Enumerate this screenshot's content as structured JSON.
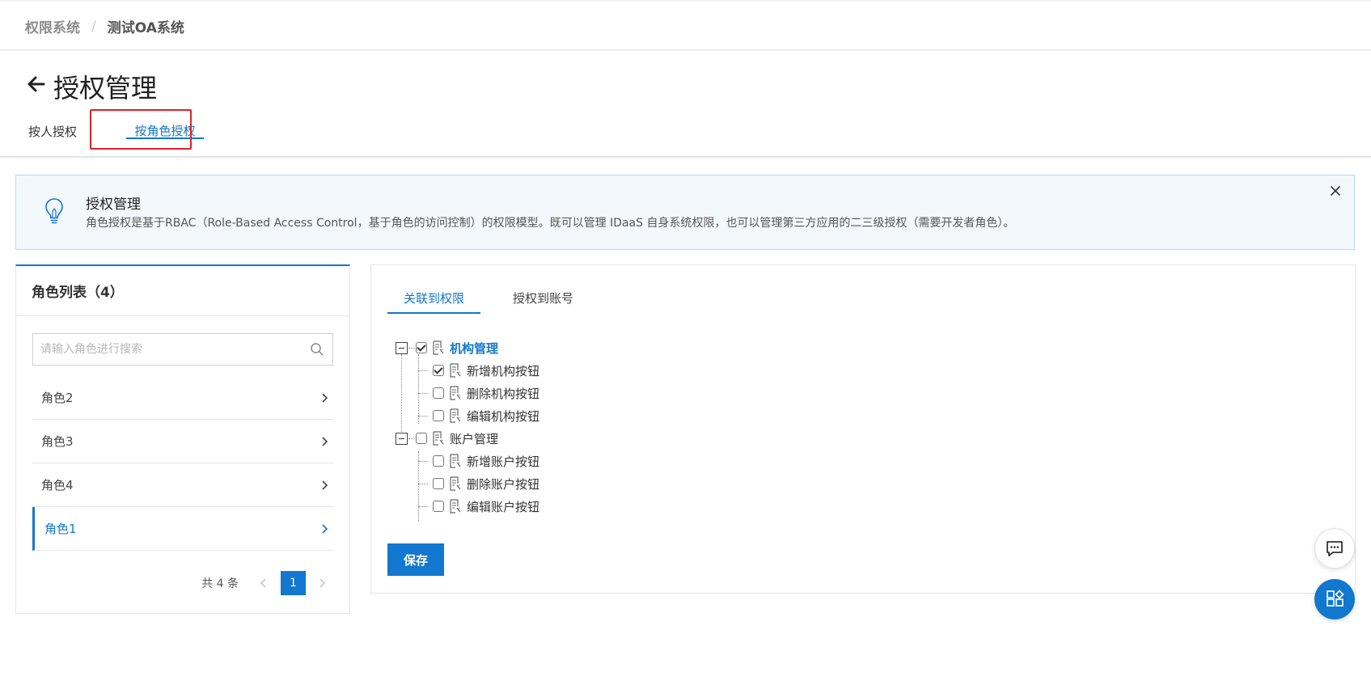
{
  "breadcrumb": {
    "root": "权限系统",
    "separator": "/",
    "current": "测试OA系统"
  },
  "header": {
    "title": "授权管理"
  },
  "tabs": [
    {
      "label": "按人授权",
      "active": false
    },
    {
      "label": "按角色授权",
      "active": true
    }
  ],
  "notice": {
    "title": "授权管理",
    "text": "角色授权是基于RBAC（Role-Based Access Control，基于角色的访问控制）的权限模型。既可以管理 IDaaS 自身系统权限，也可以管理第三方应用的二三级授权（需要开发者角色）。"
  },
  "role_panel": {
    "title": "角色列表（4）",
    "search_placeholder": "请输入角色进行搜索",
    "roles": [
      {
        "label": "角色2",
        "active": false
      },
      {
        "label": "角色3",
        "active": false
      },
      {
        "label": "角色4",
        "active": false
      },
      {
        "label": "角色1",
        "active": true
      }
    ],
    "pagination": {
      "total": "共 4 条",
      "current_page": "1"
    }
  },
  "perm_panel": {
    "tabs": [
      {
        "label": "关联到权限",
        "active": true
      },
      {
        "label": "授权到账号",
        "active": false
      }
    ],
    "tree": [
      {
        "label": "机构管理",
        "checked": true,
        "level": 0,
        "highlight": true
      },
      {
        "label": "新增机构按钮",
        "checked": true,
        "level": 1
      },
      {
        "label": "删除机构按钮",
        "checked": false,
        "level": 1
      },
      {
        "label": "编辑机构按钮",
        "checked": false,
        "level": 1
      },
      {
        "label": "账户管理",
        "checked": false,
        "level": 0
      },
      {
        "label": "新增账户按钮",
        "checked": false,
        "level": 1
      },
      {
        "label": "删除账户按钮",
        "checked": false,
        "level": 1
      },
      {
        "label": "编辑账户按钮",
        "checked": false,
        "level": 1
      }
    ],
    "save_label": "保存"
  },
  "colors": {
    "primary": "#1277cf",
    "highlight_border": "#e0212a",
    "notice_bg": "#f3f8fc"
  },
  "icons": [
    "back-arrow-icon",
    "lightbulb-icon",
    "close-icon",
    "search-icon",
    "chevron-right-icon",
    "document-icon",
    "chat-icon",
    "apps-icon"
  ]
}
